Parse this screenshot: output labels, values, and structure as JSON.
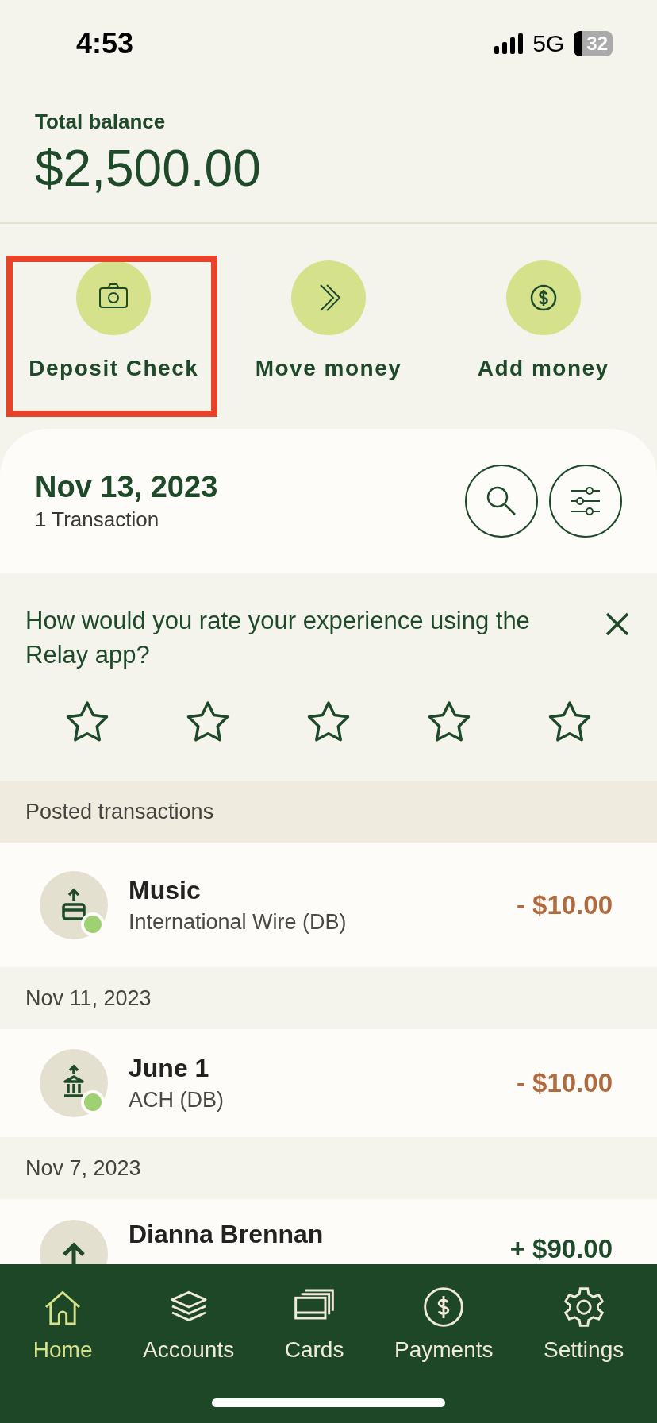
{
  "status_bar": {
    "time": "4:53",
    "network": "5G",
    "battery": "32"
  },
  "balance": {
    "label": "Total balance",
    "amount": "$2,500.00"
  },
  "actions": [
    {
      "kind": "camera",
      "label": "Deposit Check",
      "highlighted": true
    },
    {
      "kind": "move",
      "label": "Move money",
      "highlighted": false
    },
    {
      "kind": "add",
      "label": "Add money",
      "highlighted": false
    }
  ],
  "day_header": {
    "date": "Nov 13, 2023",
    "count": "1 Transaction"
  },
  "survey": {
    "question": "How would you rate your experience using the Relay app?",
    "stars": 0
  },
  "posted_header": "Posted transactions",
  "feed": [
    {
      "kind": "debit",
      "name": "Music",
      "type": "International Wire (DB)",
      "amount": "- $10.00",
      "color": "#9fd072"
    },
    {
      "kind": "date",
      "label": "Nov 11, 2023"
    },
    {
      "kind": "debit",
      "name": "June 1",
      "type": "ACH (DB)",
      "amount": "- $10.00",
      "color": "#9fd072"
    },
    {
      "kind": "date",
      "label": "Nov 7, 2023"
    },
    {
      "kind": "credit",
      "name": "Dianna Brennan",
      "amount": "+ $90.00"
    }
  ],
  "nav": [
    {
      "label": "Home",
      "selected": true
    },
    {
      "label": "Accounts",
      "selected": false
    },
    {
      "label": "Cards",
      "selected": false
    },
    {
      "label": "Payments",
      "selected": false
    },
    {
      "label": "Settings",
      "selected": false
    }
  ]
}
